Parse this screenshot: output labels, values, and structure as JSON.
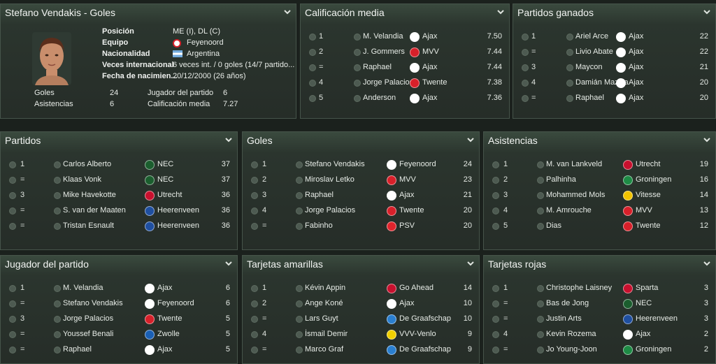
{
  "profile": {
    "title": "Stefano Vendakis - Goles",
    "fields": [
      {
        "label": "Posición",
        "value": "ME (I), DL (C)"
      },
      {
        "label": "Equipo",
        "value": "Feyenoord"
      },
      {
        "label": "Nacionalidad",
        "value": "Argentina"
      },
      {
        "label": "Veces internacional",
        "value": "6 veces int. / 0 goles (14/7 partido..."
      },
      {
        "label": "Fecha de nacimien...",
        "value": "20/12/2000 (26 años)"
      }
    ],
    "stats": [
      {
        "label": "Goles",
        "value": "24"
      },
      {
        "label": "Asistencias",
        "value": "6"
      },
      {
        "label": "Jugador del partido",
        "value": "6"
      },
      {
        "label": "Calificación media",
        "value": "7.27"
      }
    ]
  },
  "colors": {
    "Ajax": "#ffffff",
    "MVV": "#d8202a",
    "Twente": "#d8202a",
    "Feyenoord": "#ffffff",
    "NEC": "#1b5e2e",
    "Utrecht": "#c8102e",
    "Heerenveen": "#1f4fa0",
    "PSV": "#e0242c",
    "Groningen": "#1e8b45",
    "Vitesse": "#f2c300",
    "Go Ahead": "#c8102e",
    "De Graafschap": "#2a7fd0",
    "VVV-Venlo": "#f2d000",
    "Sparta": "#c8102e",
    "Zwolle": "#1a5fb4"
  },
  "panels": [
    {
      "id": "calificacion",
      "title": "Calificación media",
      "rows": [
        {
          "rank": "1",
          "player": "M. Velandia",
          "team": "Ajax",
          "value": "7.50"
        },
        {
          "rank": "2",
          "player": "J. Gommers",
          "team": "MVV",
          "value": "7.44"
        },
        {
          "rank": "=",
          "player": "Raphael",
          "team": "Ajax",
          "value": "7.44"
        },
        {
          "rank": "4",
          "player": "Jorge Palacios",
          "team": "Twente",
          "value": "7.38"
        },
        {
          "rank": "5",
          "player": "Anderson",
          "team": "Ajax",
          "value": "7.36"
        }
      ]
    },
    {
      "id": "ganados",
      "title": "Partidos ganados",
      "rows": [
        {
          "rank": "1",
          "player": "Ariel Arce",
          "team": "Ajax",
          "value": "22"
        },
        {
          "rank": "=",
          "player": "Livio Abate",
          "team": "Ajax",
          "value": "22"
        },
        {
          "rank": "3",
          "player": "Maycon",
          "team": "Ajax",
          "value": "21"
        },
        {
          "rank": "4",
          "player": "Damián Mazzia",
          "team": "Ajax",
          "value": "20"
        },
        {
          "rank": "=",
          "player": "Raphael",
          "team": "Ajax",
          "value": "20"
        }
      ]
    },
    {
      "id": "partidos",
      "title": "Partidos",
      "rows": [
        {
          "rank": "1",
          "player": "Carlos Alberto",
          "team": "NEC",
          "value": "37"
        },
        {
          "rank": "=",
          "player": "Klaas Vonk",
          "team": "NEC",
          "value": "37"
        },
        {
          "rank": "3",
          "player": "Mike Havekotte",
          "team": "Utrecht",
          "value": "36"
        },
        {
          "rank": "=",
          "player": "S. van der Maaten",
          "team": "Heerenveen",
          "value": "36"
        },
        {
          "rank": "=",
          "player": "Tristan Esnault",
          "team": "Heerenveen",
          "value": "36"
        }
      ]
    },
    {
      "id": "goles",
      "title": "Goles",
      "rows": [
        {
          "rank": "1",
          "player": "Stefano Vendakis",
          "team": "Feyenoord",
          "value": "24"
        },
        {
          "rank": "2",
          "player": "Miroslav Letko",
          "team": "MVV",
          "value": "23"
        },
        {
          "rank": "3",
          "player": "Raphael",
          "team": "Ajax",
          "value": "21"
        },
        {
          "rank": "4",
          "player": "Jorge Palacios",
          "team": "Twente",
          "value": "20"
        },
        {
          "rank": "=",
          "player": "Fabinho",
          "team": "PSV",
          "value": "20"
        }
      ]
    },
    {
      "id": "asistencias",
      "title": "Asistencias",
      "rows": [
        {
          "rank": "1",
          "player": "M. van Lankveld",
          "team": "Utrecht",
          "value": "19"
        },
        {
          "rank": "2",
          "player": "Palhinha",
          "team": "Groningen",
          "value": "16"
        },
        {
          "rank": "3",
          "player": "Mohammed Mols",
          "team": "Vitesse",
          "value": "14"
        },
        {
          "rank": "4",
          "player": "M. Amrouche",
          "team": "MVV",
          "value": "13"
        },
        {
          "rank": "5",
          "player": "Dias",
          "team": "Twente",
          "value": "12"
        }
      ]
    },
    {
      "id": "jugador",
      "title": "Jugador del partido",
      "rows": [
        {
          "rank": "1",
          "player": "M. Velandia",
          "team": "Ajax",
          "value": "6"
        },
        {
          "rank": "=",
          "player": "Stefano Vendakis",
          "team": "Feyenoord",
          "value": "6"
        },
        {
          "rank": "3",
          "player": "Jorge Palacios",
          "team": "Twente",
          "value": "5"
        },
        {
          "rank": "=",
          "player": "Youssef Benali",
          "team": "Zwolle",
          "value": "5"
        },
        {
          "rank": "=",
          "player": "Raphael",
          "team": "Ajax",
          "value": "5"
        }
      ]
    },
    {
      "id": "amarillas",
      "title": "Tarjetas amarillas",
      "rows": [
        {
          "rank": "1",
          "player": "Kévin Appin",
          "team": "Go Ahead",
          "value": "14"
        },
        {
          "rank": "2",
          "player": "Ange Koné",
          "team": "Ajax",
          "value": "10"
        },
        {
          "rank": "=",
          "player": "Lars Guyt",
          "team": "De Graafschap",
          "value": "10"
        },
        {
          "rank": "4",
          "player": "İsmail Demir",
          "team": "VVV-Venlo",
          "value": "9"
        },
        {
          "rank": "=",
          "player": "Marco Graf",
          "team": "De Graafschap",
          "value": "9"
        }
      ]
    },
    {
      "id": "rojas",
      "title": "Tarjetas rojas",
      "rows": [
        {
          "rank": "1",
          "player": "Christophe Laisney",
          "team": "Sparta",
          "value": "3"
        },
        {
          "rank": "=",
          "player": "Bas de Jong",
          "team": "NEC",
          "value": "3"
        },
        {
          "rank": "=",
          "player": "Justin Arts",
          "team": "Heerenveen",
          "value": "3"
        },
        {
          "rank": "4",
          "player": "Kevin Rozema",
          "team": "Ajax",
          "value": "2"
        },
        {
          "rank": "=",
          "player": "Jo Young-Joon",
          "team": "Groningen",
          "value": "2"
        }
      ]
    }
  ]
}
